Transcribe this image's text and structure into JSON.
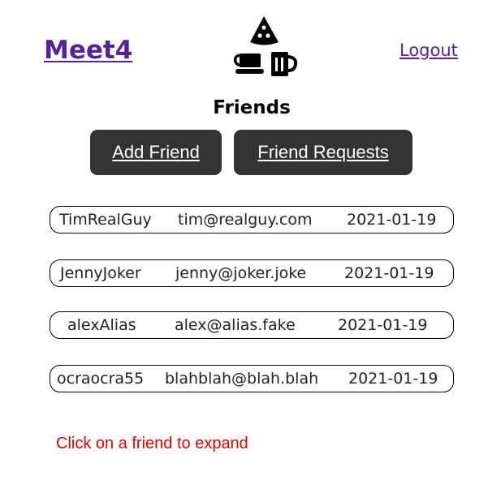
{
  "header": {
    "brand": "Meet4",
    "logo_icon": "pizza-coffee-beer-logo-icon",
    "logout_label": "Logout"
  },
  "main": {
    "title": "Friends",
    "add_friend_label": "Add Friend",
    "friend_requests_label": "Friend Requests",
    "friends": [
      {
        "username": "TimRealGuy",
        "email": "tim@realguy.com",
        "date": "2021-01-19"
      },
      {
        "username": "JennyJoker",
        "email": "jenny@joker.joke",
        "date": "2021-01-19"
      },
      {
        "username": "alexAlias",
        "email": "alex@alias.fake",
        "date": "2021-01-19"
      },
      {
        "username": "ocraocra55",
        "email": "blahblah@blah.blah",
        "date": "2021-01-19"
      }
    ],
    "hint": "Click on a friend to expand"
  },
  "colors": {
    "link": "#55229a",
    "button_bg": "#333333",
    "hint": "#e00000"
  }
}
